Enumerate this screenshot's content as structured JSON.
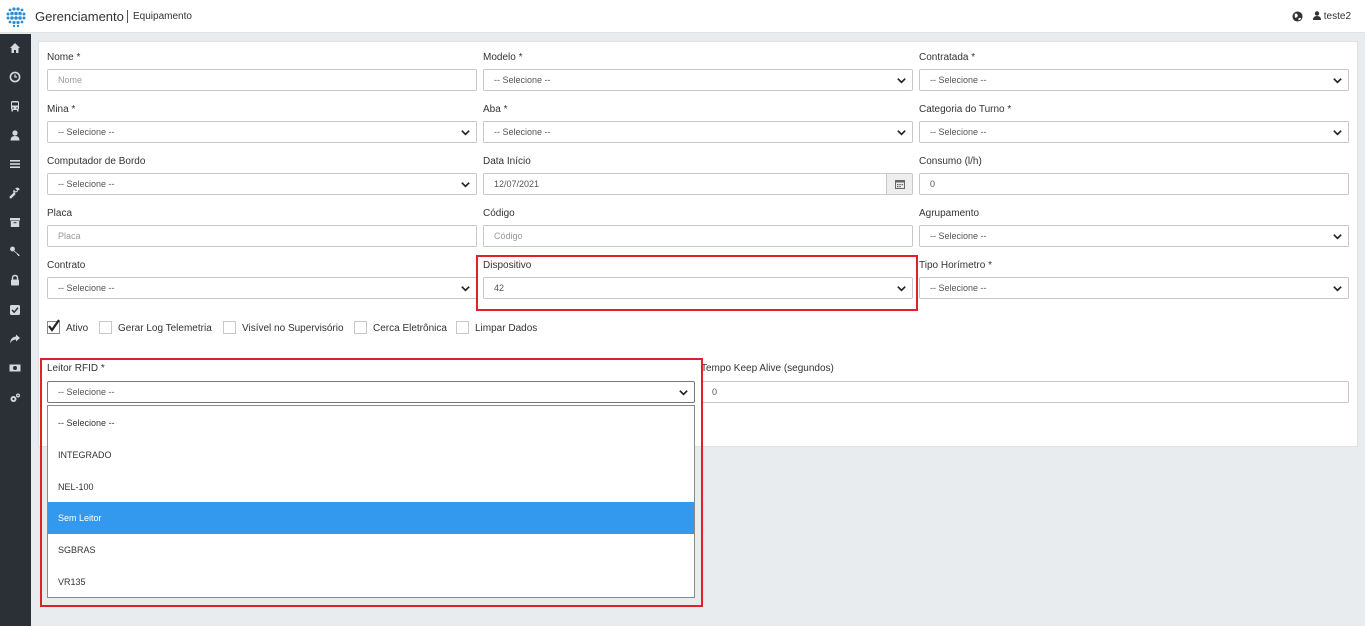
{
  "header": {
    "app_title": "Gerenciamento",
    "breadcrumb": "Equipamento",
    "user": "teste2"
  },
  "sidebar": {
    "icons": [
      "home-icon",
      "clock-icon",
      "bus-icon",
      "user-icon",
      "list-icon",
      "wrench-icon",
      "archive-icon",
      "key-icon",
      "lock-icon",
      "check-square-icon",
      "share-icon",
      "money-icon",
      "cogs-icon"
    ]
  },
  "form": {
    "nome": {
      "label": "Nome *",
      "placeholder": "Nome"
    },
    "modelo": {
      "label": "Modelo *",
      "value": "-- Selecione --"
    },
    "contratada": {
      "label": "Contratada *",
      "value": "-- Selecione --"
    },
    "mina": {
      "label": "Mina *",
      "value": "-- Selecione --"
    },
    "aba": {
      "label": "Aba *",
      "value": "-- Selecione --"
    },
    "categoria_turno": {
      "label": "Categoria do Turno *",
      "value": "-- Selecione --"
    },
    "computador_bordo": {
      "label": "Computador de Bordo",
      "value": "-- Selecione --"
    },
    "data_inicio": {
      "label": "Data Início",
      "value": "12/07/2021"
    },
    "consumo": {
      "label": "Consumo (l/h)",
      "value": "0"
    },
    "placa": {
      "label": "Placa",
      "placeholder": "Placa"
    },
    "codigo": {
      "label": "Código",
      "placeholder": "Código"
    },
    "agrupamento": {
      "label": "Agrupamento",
      "value": "-- Selecione --"
    },
    "contrato": {
      "label": "Contrato",
      "value": "-- Selecione --"
    },
    "dispositivo": {
      "label": "Dispositivo",
      "value": "42"
    },
    "tipo_horimetro": {
      "label": "Tipo Horímetro *",
      "value": "-- Selecione --"
    },
    "checkboxes": [
      {
        "label": "Ativo",
        "checked": true
      },
      {
        "label": "Gerar Log Telemetria",
        "checked": false
      },
      {
        "label": "Visível no Supervisório",
        "checked": false
      },
      {
        "label": "Cerca Eletrônica",
        "checked": false
      },
      {
        "label": "Limpar Dados",
        "checked": false
      }
    ],
    "leitor_rfid": {
      "label": "Leitor RFID *",
      "value": "-- Selecione --"
    },
    "keep_alive": {
      "label": "Tempo Keep Alive (segundos)",
      "value": "0"
    }
  },
  "dropdown": {
    "options": [
      "-- Selecione --",
      "INTEGRADO",
      "NEL-100",
      "Sem Leitor",
      "SGBRAS",
      "VR135"
    ],
    "highlighted": "Sem Leitor"
  },
  "colors": {
    "sidebar": "#2b3036",
    "highlight": "#3399ee",
    "annotation": "#e0202a"
  }
}
